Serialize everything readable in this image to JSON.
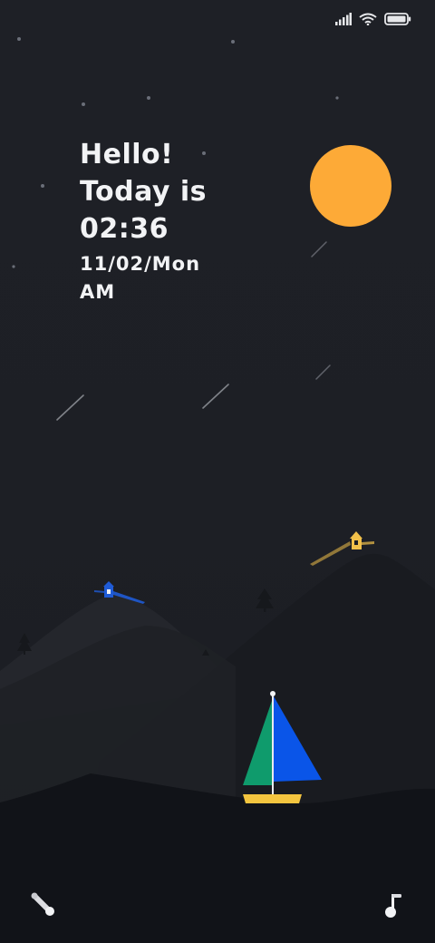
{
  "greeting": {
    "line1": "Hello!",
    "line2": "Today is",
    "time": "02:36",
    "date": "11/02/Mon",
    "period": "AM"
  },
  "status_bar": {
    "icons": [
      "signal-icon",
      "wifi-icon",
      "battery-icon"
    ]
  },
  "scene": {
    "sun_color": "#fdaa37",
    "sail_left_color": "#0f9b6c",
    "sail_right_color": "#0a55e8",
    "hull_color": "#f4c53f",
    "lighthouse_left_color": "#1f5bd6",
    "lighthouse_right_color": "#f1c04a"
  },
  "dock": {
    "left_icon": "phone-icon",
    "right_icon": "music-note-icon"
  }
}
